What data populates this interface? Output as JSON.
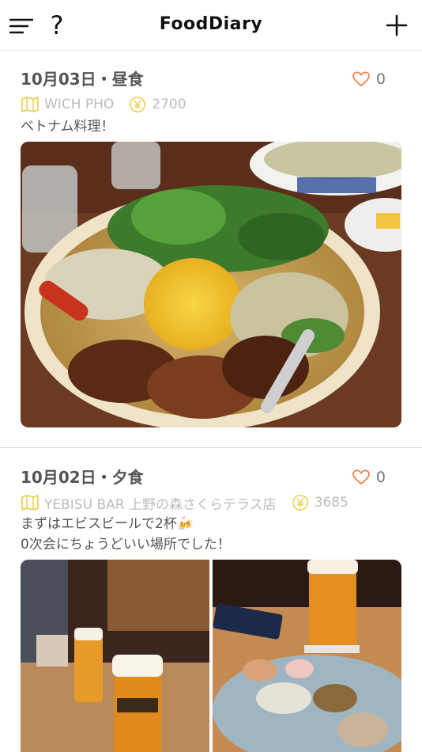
{
  "header": {
    "title": "FoodDiary",
    "menu_icon": "hamburger-icon",
    "help_label": "?",
    "add_icon": "plus-icon"
  },
  "entries": [
    {
      "date_meal": "10月03日・昼食",
      "likes": "0",
      "place": "WICH PHO",
      "price": "2700",
      "comment": "ベトナム料理！",
      "photos": [
        "vietnamese-rice-platter-photo"
      ]
    },
    {
      "date_meal": "10月02日・夕食",
      "likes": "0",
      "place": "YEBISU BAR 上野の森さくらテラス店",
      "price": "3685",
      "comment": "まずはエビスビールで2杯🍻\n0次会にちょうどいい場所でした！",
      "photos": [
        "beer-glasses-photo",
        "appetizer-plate-photo"
      ]
    }
  ],
  "colors": {
    "heart": "#f0824a",
    "place_icon": "#e8d35a",
    "yen_icon": "#e8d35a",
    "meta_text": "#bcbcbc"
  }
}
